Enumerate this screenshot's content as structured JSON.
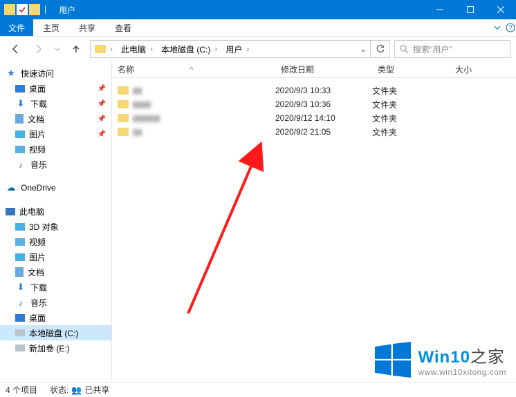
{
  "title": "用户",
  "ribbon": {
    "file": "文件",
    "tabs": [
      "主页",
      "共享",
      "查看"
    ]
  },
  "nav": {
    "breadcrumb": [
      "此电脑",
      "本地磁盘 (C:)",
      "用户"
    ],
    "search_placeholder": "搜索\"用户\""
  },
  "sidebar": {
    "quick_access": "快速访问",
    "quick_items": [
      {
        "label": "桌面",
        "icon": "desktop"
      },
      {
        "label": "下载",
        "icon": "download"
      },
      {
        "label": "文档",
        "icon": "doc"
      },
      {
        "label": "图片",
        "icon": "pic"
      },
      {
        "label": "视频",
        "icon": "video"
      },
      {
        "label": "音乐",
        "icon": "music"
      }
    ],
    "onedrive": "OneDrive",
    "this_pc": "此电脑",
    "pc_items": [
      {
        "label": "3D 对象",
        "icon": "3d"
      },
      {
        "label": "视频",
        "icon": "video"
      },
      {
        "label": "图片",
        "icon": "pic"
      },
      {
        "label": "文档",
        "icon": "doc"
      },
      {
        "label": "下载",
        "icon": "download"
      },
      {
        "label": "音乐",
        "icon": "music"
      },
      {
        "label": "桌面",
        "icon": "desktop"
      },
      {
        "label": "本地磁盘 (C:)",
        "icon": "drive",
        "selected": true
      },
      {
        "label": "新加卷 (E:)",
        "icon": "drive"
      }
    ]
  },
  "columns": {
    "name": "名称",
    "date": "修改日期",
    "type": "类型",
    "size": "大小",
    "sort_indicator": "^"
  },
  "files": [
    {
      "name": "▮▮",
      "date": "2020/9/3 10:33",
      "type": "文件夹"
    },
    {
      "name": "▮▮▮▮",
      "date": "2020/9/3 10:36",
      "type": "文件夹"
    },
    {
      "name": "▮▮▮▮▮▮",
      "date": "2020/9/12 14:10",
      "type": "文件夹"
    },
    {
      "name": "▮▮",
      "date": "2020/9/2 21:05",
      "type": "文件夹"
    }
  ],
  "status": {
    "items": "4 个项目",
    "state_label": "状态:",
    "state_value": "已共享"
  },
  "watermark": {
    "brand_win": "Win",
    "brand_num": "10",
    "brand_suffix": "之家",
    "url": "www.win10xitong.com"
  }
}
